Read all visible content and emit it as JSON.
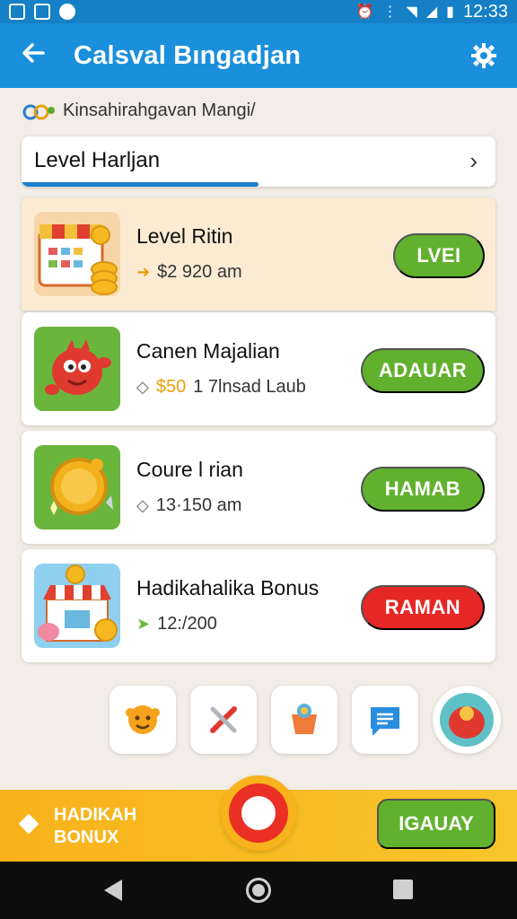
{
  "status_bar": {
    "time": "12:33",
    "left_icons": [
      "notification-icon",
      "image-icon",
      "circle-icon"
    ],
    "right_icons": [
      "alarm-icon",
      "vibrate-icon",
      "wifi-icon",
      "signal-icon",
      "battery-icon"
    ]
  },
  "app_bar": {
    "title": "Calsval Bıngadjan",
    "back_icon": "arrow-left-icon",
    "settings_icon": "gear-icon",
    "color": "#1a8fdb"
  },
  "subtitle": "Kinsahirahgavan Mangi/",
  "level": {
    "title": "Level Harljan",
    "progress": 0.5
  },
  "tasks": [
    {
      "title": "Level Ritin",
      "meta": "$2 920 am",
      "meta_accent": "",
      "button": "LVEI",
      "button_color": "#62b12e",
      "icon": "calendar-coins-icon"
    },
    {
      "title": "Canen Majalian",
      "meta": "1 7lnsad Laub",
      "meta_accent": "$50",
      "button": "ADAUAR",
      "button_color": "#62b12e",
      "icon": "red-monster-icon"
    },
    {
      "title": "Coure l rian",
      "meta": "13·150 am",
      "meta_accent": "",
      "button": "HAMAB",
      "button_color": "#62b12e",
      "icon": "gold-coin-icon"
    },
    {
      "title": "Hadikahalika Bonus",
      "meta": "12:/200",
      "meta_accent": "",
      "button": "RAMAN",
      "button_color": "#e52725",
      "icon": "shop-coins-icon"
    }
  ],
  "shortcuts": [
    "smiley-icon",
    "tools-icon",
    "cup-icon",
    "chat-icon",
    "avatar-icon"
  ],
  "bonus_bar": {
    "label": "HADIKAH BONUX",
    "button": "IGAUAY"
  },
  "nav_bar": [
    "back-icon",
    "home-icon",
    "recent-apps-icon"
  ]
}
